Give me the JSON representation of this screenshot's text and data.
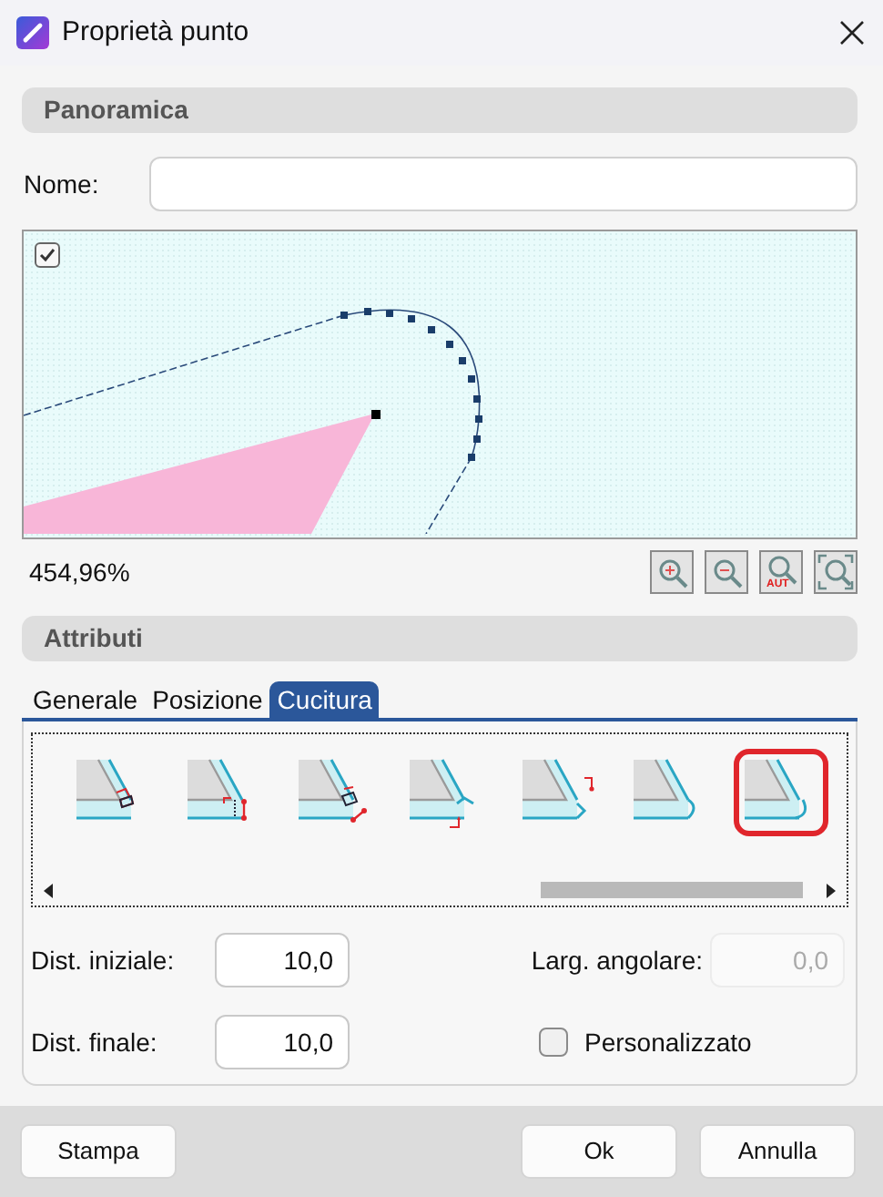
{
  "window": {
    "title": "Proprietà punto"
  },
  "overview": {
    "header": "Panoramica",
    "name_label": "Nome:",
    "preview": {
      "checked": true
    },
    "zoom_value": "454,96%",
    "zoom_buttons": [
      {
        "kind": "in"
      },
      {
        "kind": "out"
      },
      {
        "kind": "auto",
        "badge": "AUT"
      },
      {
        "kind": "fit"
      }
    ]
  },
  "attributes": {
    "header": "Attributi",
    "tabs": [
      {
        "label": "Generale",
        "selected": false
      },
      {
        "label": "Posizione",
        "selected": false
      },
      {
        "label": "Cucitura",
        "selected": true
      }
    ],
    "seam_styles": [
      {
        "kind": "lock",
        "selected": false
      },
      {
        "kind": "step",
        "selected": false
      },
      {
        "kind": "angled",
        "selected": false
      },
      {
        "kind": "notch",
        "selected": false
      },
      {
        "kind": "zigzag",
        "selected": false
      },
      {
        "kind": "hook",
        "selected": false
      },
      {
        "kind": "round",
        "selected": true
      }
    ],
    "fields": [
      {
        "kind": "input",
        "label": "Dist. iniziale:",
        "value": "10,0",
        "disabled": false
      },
      {
        "kind": "input",
        "label": "Larg. angolare:",
        "value": "0,0",
        "disabled": true
      },
      {
        "kind": "input",
        "label": "Dist. finale:",
        "value": "10,0",
        "disabled": false
      },
      {
        "kind": "checkbox",
        "label": "Personalizzato",
        "checked": false
      }
    ]
  },
  "buttons": [
    {
      "label": "Stampa",
      "kind": "left"
    },
    {
      "label": "Ok",
      "kind": "right"
    },
    {
      "label": "Annulla",
      "kind": "right"
    }
  ]
}
